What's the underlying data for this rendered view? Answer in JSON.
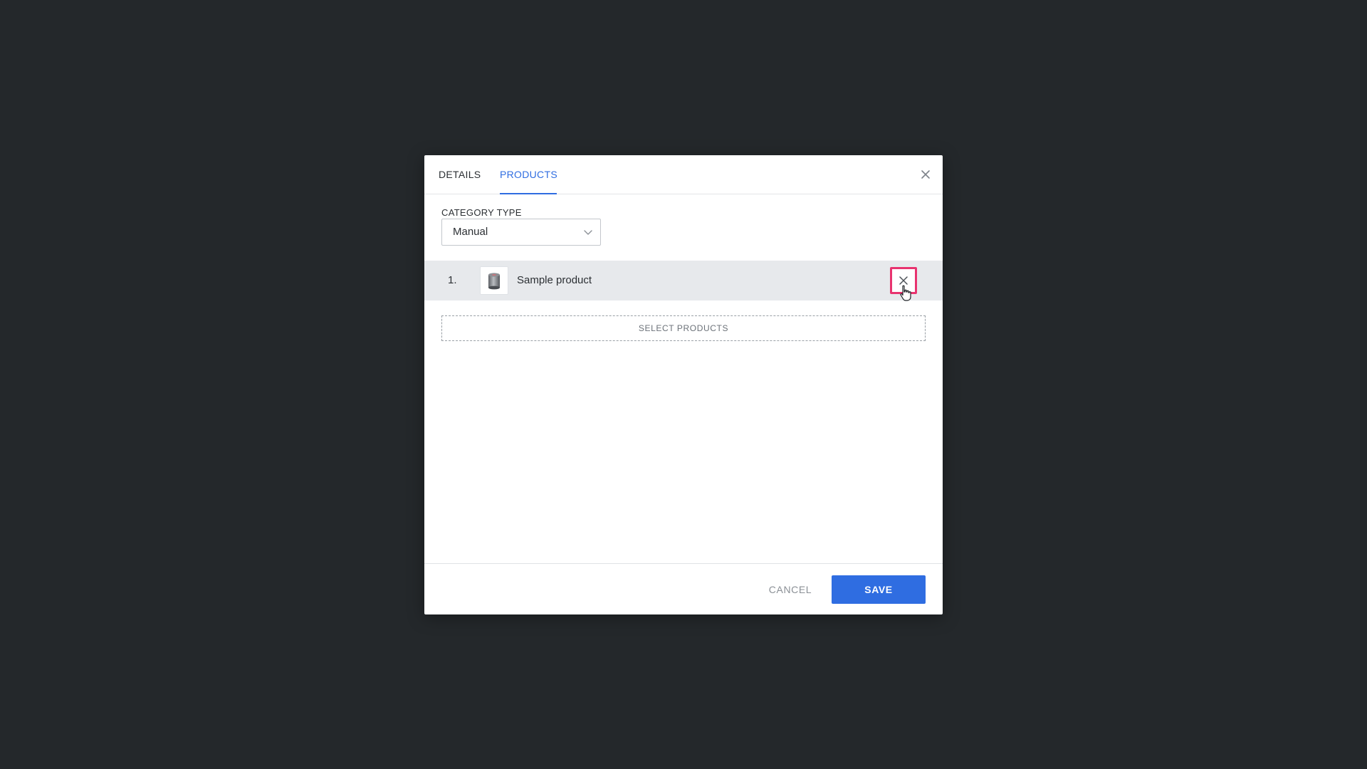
{
  "dialog": {
    "tabs": [
      {
        "label": "DETAILS",
        "active": false
      },
      {
        "label": "PRODUCTS",
        "active": true
      }
    ],
    "close_icon": "close-icon"
  },
  "category_type": {
    "label": "CATEGORY TYPE",
    "selected": "Manual",
    "icon": "chevron-down-icon"
  },
  "products": [
    {
      "index": "1.",
      "name": "Sample product",
      "thumbnail": "product-thumbnail",
      "remove_icon": "close-icon"
    }
  ],
  "select_products_label": "SELECT PRODUCTS",
  "footer": {
    "cancel_label": "CANCEL",
    "save_label": "SAVE"
  },
  "colors": {
    "backdrop": "#24282b",
    "accent": "#2f6de1",
    "highlight": "#e8336f",
    "row_background": "#e7e9ec"
  }
}
